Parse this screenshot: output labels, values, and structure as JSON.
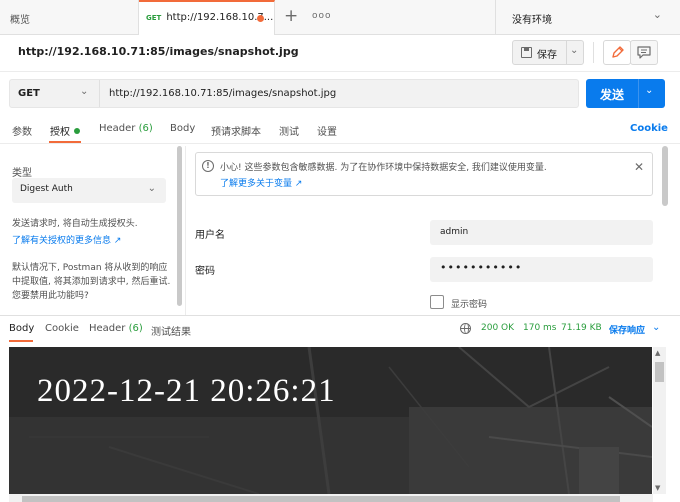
{
  "tabs": {
    "overview_label": "概览",
    "active_method": "GET",
    "active_url": "http://192.168.10.7...",
    "plus": "+",
    "more": "ooo"
  },
  "environment": {
    "label": "没有环境",
    "caret": "⌄"
  },
  "request": {
    "title": "http://192.168.10.71:85/images/snapshot.jpg",
    "save_label": "保存",
    "method": "GET",
    "url": "http://192.168.10.71:85/images/snapshot.jpg",
    "send_label": "发送"
  },
  "request_tabs": {
    "params": "参数",
    "auth": "授权",
    "headers": "Header",
    "headers_count": "(6)",
    "body": "Body",
    "prerequest": "预请求脚本",
    "tests": "测试",
    "settings": "设置",
    "cookie": "Cookie"
  },
  "auth_panel": {
    "type_label": "类型",
    "type_value": "Digest Auth",
    "desc": "发送请求时, 将自动生成授权头.",
    "learn_link": "了解有关授权的更多信息 ↗",
    "note": "默认情况下, Postman 将从收到的响应中提取值, 将其添加到请求中, 然后重试. 您要禁用此功能吗?"
  },
  "warning": {
    "icon": "!",
    "text": "小心! 这些参数包含敏感数据. 为了在协作环境中保持数据安全, 我们建议使用变量.",
    "link": "了解更多关于变量 ↗",
    "close": "✕"
  },
  "fields": {
    "username_label": "用户名",
    "username_value": "admin",
    "password_label": "密码",
    "password_value": "•••••••••••",
    "show_password": "显示密码"
  },
  "response": {
    "tab_body": "Body",
    "tab_cookie": "Cookie",
    "tab_headers": "Header",
    "headers_count": "(6)",
    "tab_tests": "测试结果",
    "status": "200 OK",
    "time": "170 ms",
    "size": "71.19 KB",
    "save_response": "保存响应",
    "snapshot_timestamp": "2022-12-21 20:26:21"
  },
  "colors": {
    "accent": "#f26b3a",
    "primary": "#097bed",
    "success": "#2a9d3d"
  }
}
